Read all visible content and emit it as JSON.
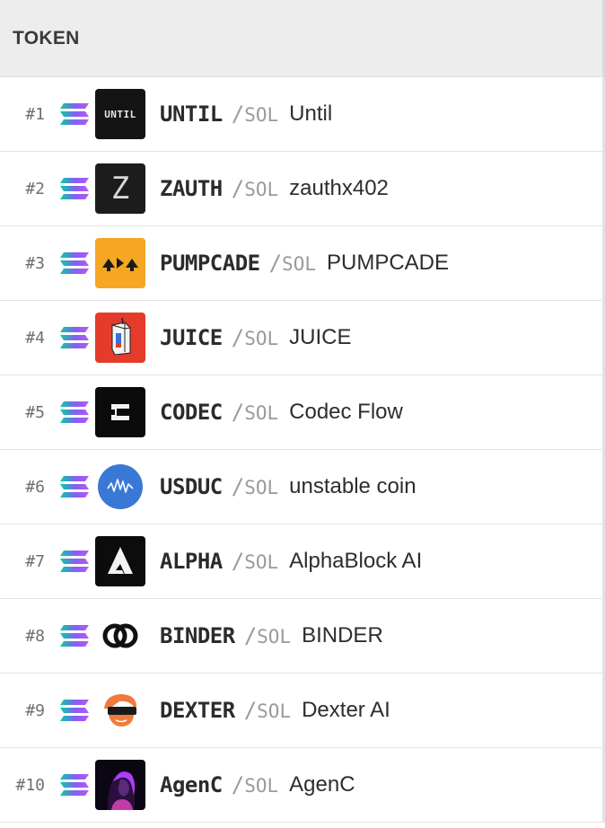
{
  "header": {
    "token_label": "TOKEN"
  },
  "quote_symbol": "SOL",
  "pair_slash": "/",
  "chain_icon": "solana-icon",
  "rows": [
    {
      "rank": "#1",
      "symbol": "UNTIL",
      "name": "Until",
      "logo_text": "UNTIL",
      "logo_icon": "until-logo"
    },
    {
      "rank": "#2",
      "symbol": "ZAUTH",
      "name": "zauthx402",
      "logo_text": "Z",
      "logo_icon": "zauth-logo"
    },
    {
      "rank": "#3",
      "symbol": "PUMPCADE",
      "name": "PUMPCADE",
      "logo_icon": "pumpcade-logo"
    },
    {
      "rank": "#4",
      "symbol": "JUICE",
      "name": "JUICE",
      "logo_icon": "juice-box-logo"
    },
    {
      "rank": "#5",
      "symbol": "CODEC",
      "name": "Codec Flow",
      "logo_icon": "codec-logo"
    },
    {
      "rank": "#6",
      "symbol": "USDUC",
      "name": "unstable coin",
      "logo_icon": "usduc-logo"
    },
    {
      "rank": "#7",
      "symbol": "ALPHA",
      "name": "AlphaBlock AI",
      "logo_icon": "alphablock-logo"
    },
    {
      "rank": "#8",
      "symbol": "BINDER",
      "name": "BINDER",
      "logo_icon": "binder-logo"
    },
    {
      "rank": "#9",
      "symbol": "DEXTER",
      "name": "Dexter AI",
      "logo_icon": "dexter-logo"
    },
    {
      "rank": "#10",
      "symbol": "AgenC",
      "name": "AgenC",
      "logo_icon": "agenc-logo"
    }
  ],
  "colors": {
    "header_bg": "#ededed",
    "solana_gradient": [
      "#00d1a0",
      "#8a5cf6",
      "#b45cf0"
    ],
    "pumpcade_bg": "#f5a623",
    "juice_bg": "#e53b2a",
    "usduc_bg": "#3a78d6",
    "dexter_orange": "#f07a3a"
  }
}
